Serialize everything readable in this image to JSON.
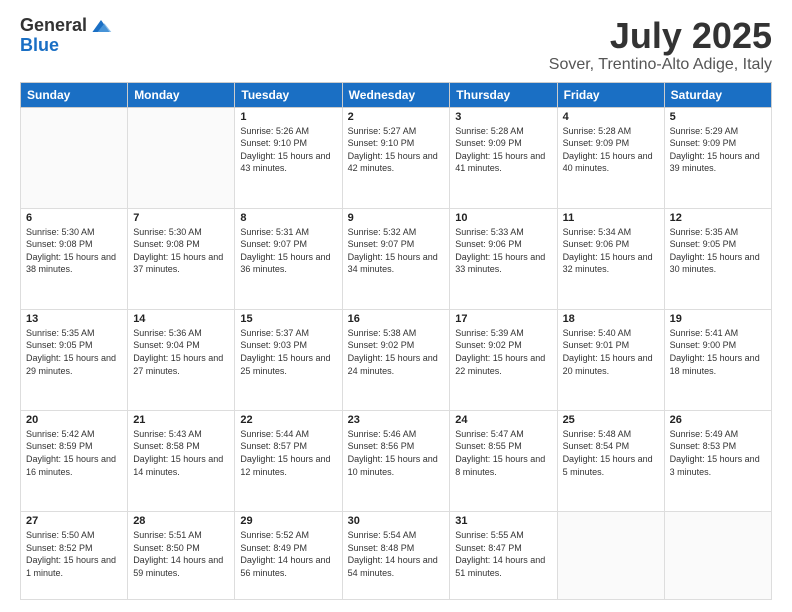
{
  "logo": {
    "general": "General",
    "blue": "Blue"
  },
  "title": {
    "month": "July 2025",
    "location": "Sover, Trentino-Alto Adige, Italy"
  },
  "weekdays": [
    "Sunday",
    "Monday",
    "Tuesday",
    "Wednesday",
    "Thursday",
    "Friday",
    "Saturday"
  ],
  "weeks": [
    [
      {
        "day": "",
        "content": ""
      },
      {
        "day": "",
        "content": ""
      },
      {
        "day": "1",
        "content": "Sunrise: 5:26 AM\nSunset: 9:10 PM\nDaylight: 15 hours and 43 minutes."
      },
      {
        "day": "2",
        "content": "Sunrise: 5:27 AM\nSunset: 9:10 PM\nDaylight: 15 hours and 42 minutes."
      },
      {
        "day": "3",
        "content": "Sunrise: 5:28 AM\nSunset: 9:09 PM\nDaylight: 15 hours and 41 minutes."
      },
      {
        "day": "4",
        "content": "Sunrise: 5:28 AM\nSunset: 9:09 PM\nDaylight: 15 hours and 40 minutes."
      },
      {
        "day": "5",
        "content": "Sunrise: 5:29 AM\nSunset: 9:09 PM\nDaylight: 15 hours and 39 minutes."
      }
    ],
    [
      {
        "day": "6",
        "content": "Sunrise: 5:30 AM\nSunset: 9:08 PM\nDaylight: 15 hours and 38 minutes."
      },
      {
        "day": "7",
        "content": "Sunrise: 5:30 AM\nSunset: 9:08 PM\nDaylight: 15 hours and 37 minutes."
      },
      {
        "day": "8",
        "content": "Sunrise: 5:31 AM\nSunset: 9:07 PM\nDaylight: 15 hours and 36 minutes."
      },
      {
        "day": "9",
        "content": "Sunrise: 5:32 AM\nSunset: 9:07 PM\nDaylight: 15 hours and 34 minutes."
      },
      {
        "day": "10",
        "content": "Sunrise: 5:33 AM\nSunset: 9:06 PM\nDaylight: 15 hours and 33 minutes."
      },
      {
        "day": "11",
        "content": "Sunrise: 5:34 AM\nSunset: 9:06 PM\nDaylight: 15 hours and 32 minutes."
      },
      {
        "day": "12",
        "content": "Sunrise: 5:35 AM\nSunset: 9:05 PM\nDaylight: 15 hours and 30 minutes."
      }
    ],
    [
      {
        "day": "13",
        "content": "Sunrise: 5:35 AM\nSunset: 9:05 PM\nDaylight: 15 hours and 29 minutes."
      },
      {
        "day": "14",
        "content": "Sunrise: 5:36 AM\nSunset: 9:04 PM\nDaylight: 15 hours and 27 minutes."
      },
      {
        "day": "15",
        "content": "Sunrise: 5:37 AM\nSunset: 9:03 PM\nDaylight: 15 hours and 25 minutes."
      },
      {
        "day": "16",
        "content": "Sunrise: 5:38 AM\nSunset: 9:02 PM\nDaylight: 15 hours and 24 minutes."
      },
      {
        "day": "17",
        "content": "Sunrise: 5:39 AM\nSunset: 9:02 PM\nDaylight: 15 hours and 22 minutes."
      },
      {
        "day": "18",
        "content": "Sunrise: 5:40 AM\nSunset: 9:01 PM\nDaylight: 15 hours and 20 minutes."
      },
      {
        "day": "19",
        "content": "Sunrise: 5:41 AM\nSunset: 9:00 PM\nDaylight: 15 hours and 18 minutes."
      }
    ],
    [
      {
        "day": "20",
        "content": "Sunrise: 5:42 AM\nSunset: 8:59 PM\nDaylight: 15 hours and 16 minutes."
      },
      {
        "day": "21",
        "content": "Sunrise: 5:43 AM\nSunset: 8:58 PM\nDaylight: 15 hours and 14 minutes."
      },
      {
        "day": "22",
        "content": "Sunrise: 5:44 AM\nSunset: 8:57 PM\nDaylight: 15 hours and 12 minutes."
      },
      {
        "day": "23",
        "content": "Sunrise: 5:46 AM\nSunset: 8:56 PM\nDaylight: 15 hours and 10 minutes."
      },
      {
        "day": "24",
        "content": "Sunrise: 5:47 AM\nSunset: 8:55 PM\nDaylight: 15 hours and 8 minutes."
      },
      {
        "day": "25",
        "content": "Sunrise: 5:48 AM\nSunset: 8:54 PM\nDaylight: 15 hours and 5 minutes."
      },
      {
        "day": "26",
        "content": "Sunrise: 5:49 AM\nSunset: 8:53 PM\nDaylight: 15 hours and 3 minutes."
      }
    ],
    [
      {
        "day": "27",
        "content": "Sunrise: 5:50 AM\nSunset: 8:52 PM\nDaylight: 15 hours and 1 minute."
      },
      {
        "day": "28",
        "content": "Sunrise: 5:51 AM\nSunset: 8:50 PM\nDaylight: 14 hours and 59 minutes."
      },
      {
        "day": "29",
        "content": "Sunrise: 5:52 AM\nSunset: 8:49 PM\nDaylight: 14 hours and 56 minutes."
      },
      {
        "day": "30",
        "content": "Sunrise: 5:54 AM\nSunset: 8:48 PM\nDaylight: 14 hours and 54 minutes."
      },
      {
        "day": "31",
        "content": "Sunrise: 5:55 AM\nSunset: 8:47 PM\nDaylight: 14 hours and 51 minutes."
      },
      {
        "day": "",
        "content": ""
      },
      {
        "day": "",
        "content": ""
      }
    ]
  ]
}
